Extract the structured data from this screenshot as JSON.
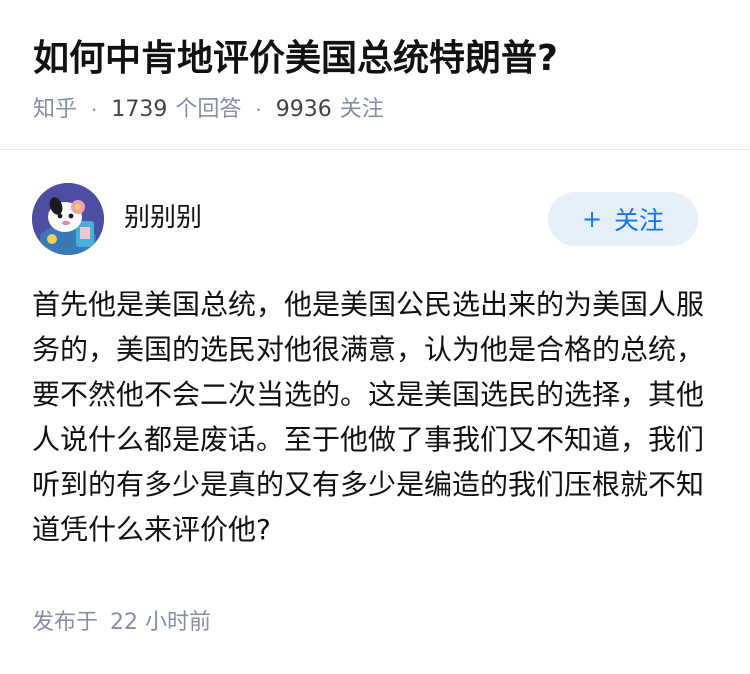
{
  "question": {
    "title": "如何中肯地评价美国总统特朗普?",
    "source": "知乎",
    "answer_count": "1739",
    "answer_label": "个回答",
    "follower_count": "9936",
    "follower_label": "关注"
  },
  "author": {
    "name": "别别别",
    "follow_label": "关注",
    "follow_icon": "plus-icon"
  },
  "answer": {
    "content": "首先他是美国总统，他是美国公民选出来的为美国人服务的，美国的选民对他很满意，认为他是合格的总统，要不然他不会二次当选的。这是美国选民的选择，其他人说什么都是废话。至于他做了事我们又不知道，我们听到的有多少是真的又有多少是编造的我们压根就不知道凭什么来评价他?",
    "published_label": "发布于",
    "published_time": "22 小时前"
  },
  "colors": {
    "accent": "#1772f6",
    "follow_bg": "#e6f0fb",
    "meta_gray": "#8590a6",
    "text": "#121212"
  }
}
